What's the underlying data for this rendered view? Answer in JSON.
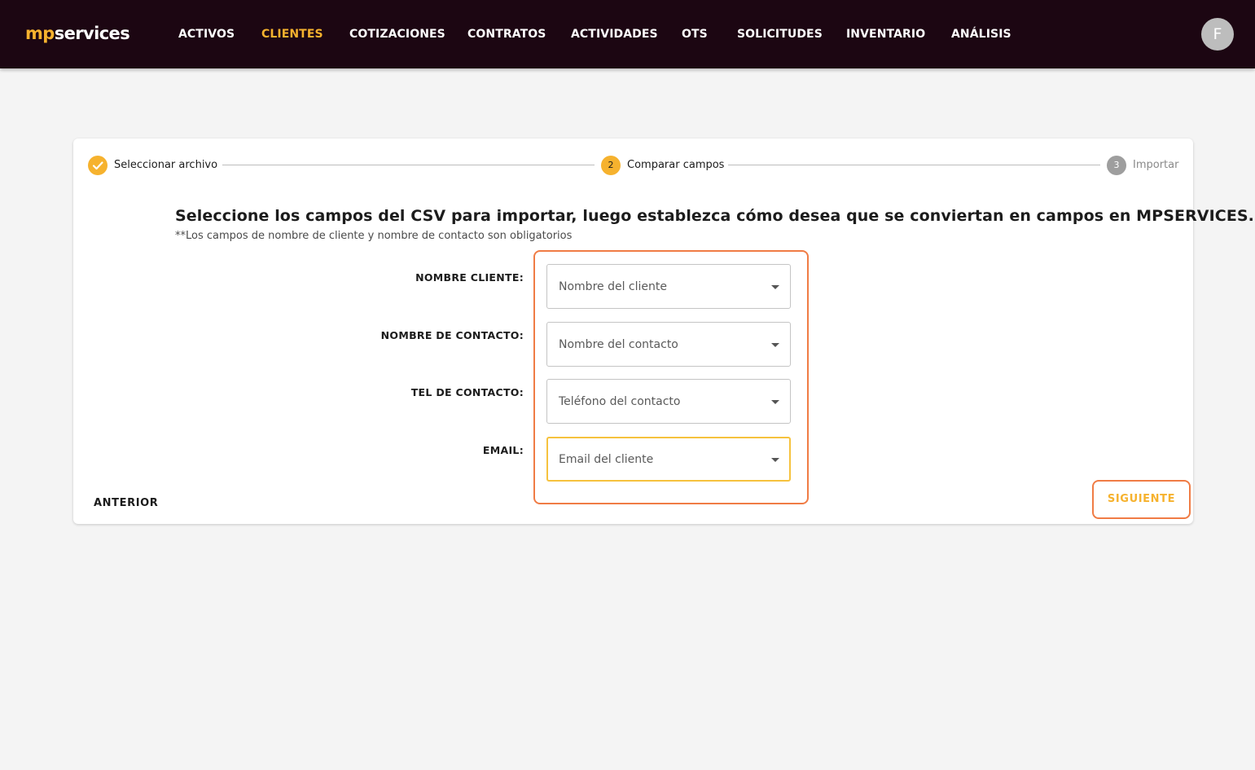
{
  "brand": {
    "prefix": "mp",
    "suffix": "services"
  },
  "nav": {
    "items": [
      {
        "label": "ACTIVOS"
      },
      {
        "label": "CLIENTES"
      },
      {
        "label": "COTIZACIONES"
      },
      {
        "label": "CONTRATOS"
      },
      {
        "label": "ACTIVIDADES"
      },
      {
        "label": "OTS"
      },
      {
        "label": "SOLICITUDES"
      },
      {
        "label": "INVENTARIO"
      },
      {
        "label": "ANÁLISIS"
      }
    ],
    "active": "CLIENTES"
  },
  "user": {
    "avatar_initial": "F"
  },
  "stepper": {
    "steps": [
      {
        "number": "1",
        "label": "Seleccionar archivo",
        "state": "completed",
        "icon": "check-icon"
      },
      {
        "number": "2",
        "label": "Comparar campos",
        "state": "active"
      },
      {
        "number": "3",
        "label": "Importar",
        "state": "pending"
      }
    ]
  },
  "main": {
    "title": "Seleccione los campos del CSV para importar, luego establezca cómo desea que se conviertan en campos en MPSERVICES.",
    "note": "**Los campos de nombre de cliente y nombre de contacto son obligatorios"
  },
  "form": {
    "fields": [
      {
        "label": "NOMBRE CLIENTE:",
        "placeholder": "Nombre del cliente"
      },
      {
        "label": "NOMBRE DE CONTACTO:",
        "placeholder": "Nombre del contacto"
      },
      {
        "label": "TEL DE CONTACTO:",
        "placeholder": "Teléfono del contacto"
      },
      {
        "label": "EMAIL:",
        "placeholder": "Email del cliente"
      }
    ],
    "focused_field": "EMAIL:"
  },
  "actions": {
    "previous": "ANTERIOR",
    "next": "SIGUIENTE"
  },
  "colors": {
    "topbar": "#1c0612",
    "accent": "#f6b22e",
    "highlight": "#f07c45",
    "background": "#f4f4f4"
  }
}
